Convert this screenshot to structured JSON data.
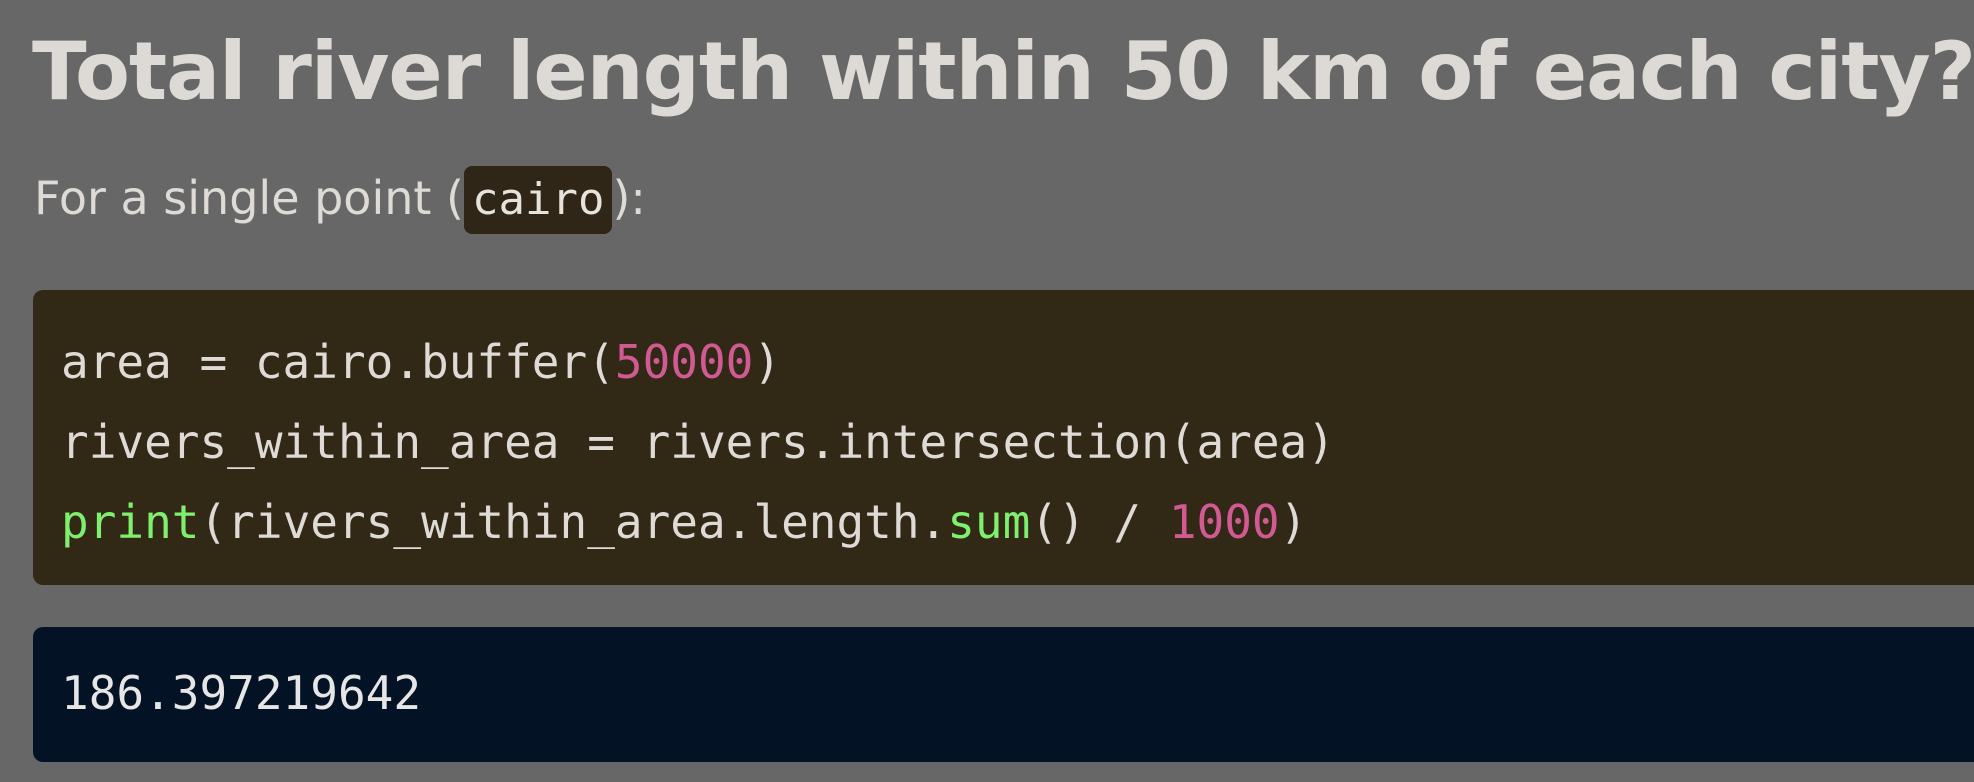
{
  "heading": "Total river length within 50 km of each city?",
  "intro": {
    "prefix": "For a single point (",
    "code": "cairo",
    "suffix": "):"
  },
  "code": {
    "line1": {
      "a": "area = cairo.buffer(",
      "num": "50000",
      "b": ")"
    },
    "line2": {
      "a": "rivers_within_area = rivers.intersection(area)"
    },
    "line3": {
      "fn1": "print",
      "a": "(rivers_within_area.length.",
      "fn2": "sum",
      "b": "() / ",
      "num": "1000",
      "c": ")"
    }
  },
  "output": "186.397219642",
  "colors": {
    "background": "#676767",
    "code_bg": "#322816",
    "output_bg": "#031325",
    "number": "#d15a93",
    "function": "#7ff06e"
  }
}
